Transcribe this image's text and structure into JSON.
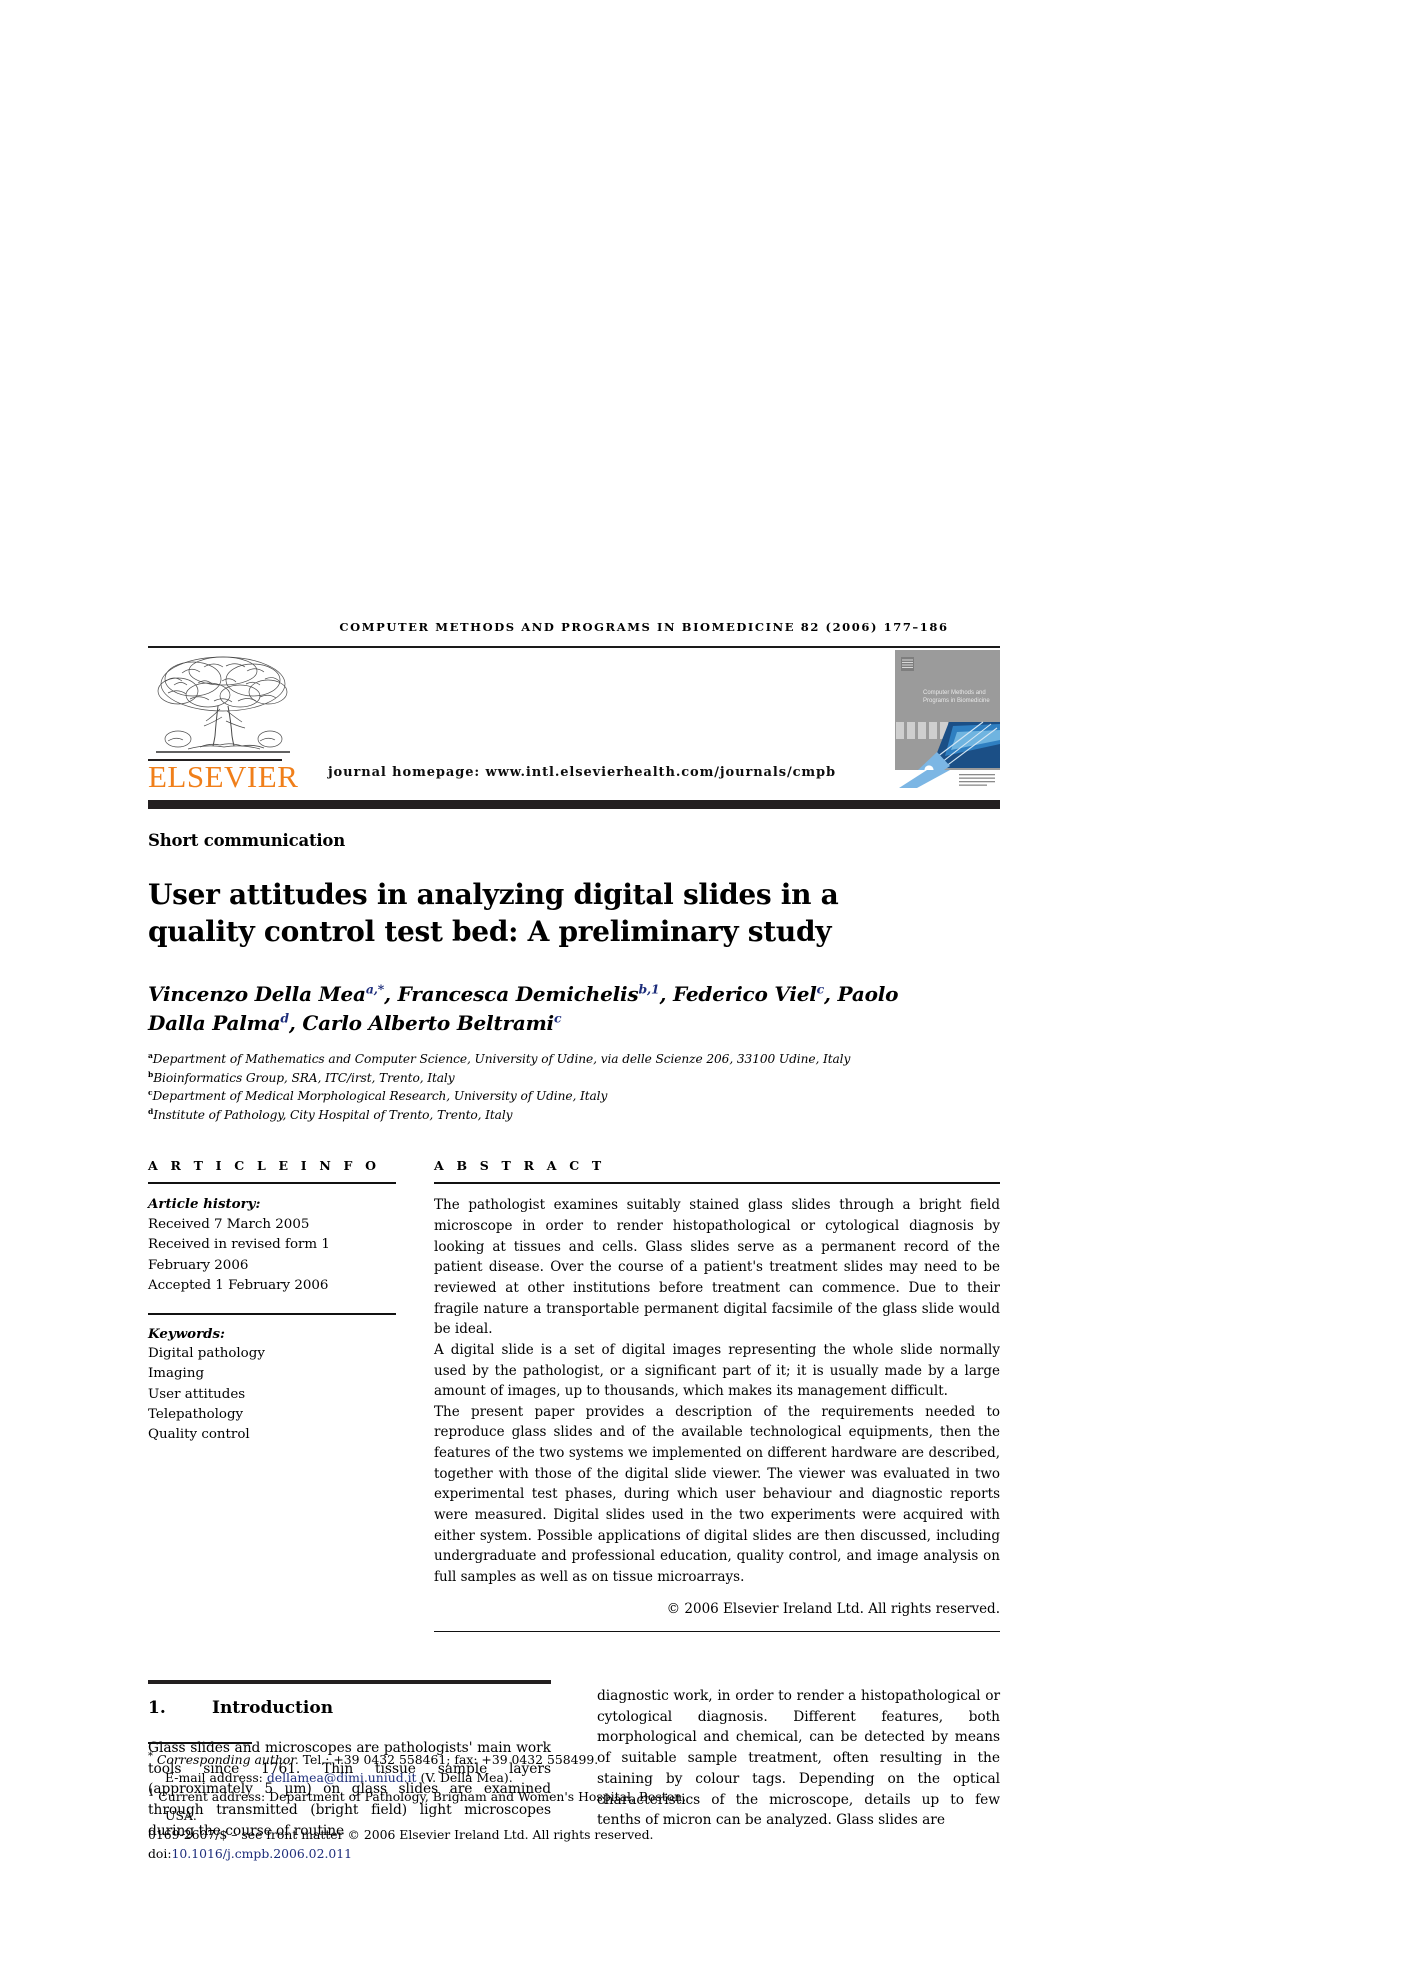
{
  "running_head": "COMPUTER METHODS AND PROGRAMS IN BIOMEDICINE 82 (2006) 177–186",
  "masthead": {
    "publisher": "ELSEVIER",
    "homepage": "journal homepage: www.intl.elsevierhealth.com/journals/cmpb",
    "cover": {
      "journal_title_line1": "Computer Methods and",
      "journal_title_line2": "Programs in Biomedicine"
    },
    "colors": {
      "elsevier_orange": "#F07F1A",
      "rule_dark": "#231f20",
      "cover_gray": "#9d9d9d",
      "cover_blue": "#2b6cb0"
    }
  },
  "article_type": "Short communication",
  "title": "User attitudes in analyzing digital slides in a quality control test bed: A preliminary study",
  "authors_html": "Vincenzo Della Mea<sup>a,*</sup>, Francesca Demichelis<sup>b,1</sup>, Federico Viel<sup>c</sup>, Paolo Dalla Palma<sup>d</sup>, Carlo Alberto Beltrami<sup>c</sup>",
  "affiliations": [
    {
      "mark": "a",
      "text": "Department of Mathematics and Computer Science, University of Udine, via delle Scienze 206, 33100 Udine, Italy"
    },
    {
      "mark": "b",
      "text": "Bioinformatics Group, SRA, ITC/irst, Trento, Italy"
    },
    {
      "mark": "c",
      "text": "Department of Medical Morphological Research, University of Udine, Italy"
    },
    {
      "mark": "d",
      "text": "Institute of Pathology, City Hospital of Trento, Trento, Italy"
    }
  ],
  "article_info": {
    "label": "A R T I C L E   I N F O",
    "history_heading": "Article history:",
    "history": [
      "Received 7 March 2005",
      "Received in revised form 1 February 2006",
      "Accepted 1 February 2006"
    ],
    "keywords_heading": "Keywords:",
    "keywords": [
      "Digital pathology",
      "Imaging",
      "User attitudes",
      "Telepathology",
      "Quality control"
    ]
  },
  "abstract": {
    "label": "A B S T R A C T",
    "paragraphs": [
      "The pathologist examines suitably stained glass slides through a bright field microscope in order to render histopathological or cytological diagnosis by looking at tissues and cells. Glass slides serve as a permanent record of the patient disease. Over the course of a patient's treatment slides may need to be reviewed at other institutions before treatment can commence. Due to their fragile nature a transportable permanent digital facsimile of the glass slide would be ideal.",
      "A digital slide is a set of digital images representing the whole slide normally used by the pathologist, or a significant part of it; it is usually made by a large amount of images, up to thousands, which makes its management difficult.",
      "The present paper provides a description of the requirements needed to reproduce glass slides and of the available technological equipments, then the features of the two systems we implemented on different hardware are described, together with those of the digital slide viewer. The viewer was evaluated in two experimental test phases, during which user behaviour and diagnostic reports were measured. Digital slides used in the two experiments were acquired with either system. Possible applications of digital slides are then discussed, including undergraduate and professional education, quality control, and image analysis on full samples as well as on tissue microarrays."
    ],
    "copyright": "© 2006 Elsevier Ireland Ltd. All rights reserved."
  },
  "section": {
    "number": "1.",
    "heading": "Introduction",
    "left_column": "Glass slides and microscopes are pathologists' main work tools since 1761. Thin tissue sample layers (approximately 5 µm) on glass slides are examined through transmitted (bright field) light microscopes during the course of routine",
    "right_column": "diagnostic work, in order to render a histopathological or cytological diagnosis. Different features, both morphological and chemical, can be detected by means of suitable sample treatment, often resulting in the staining by colour tags. Depending on the optical characteristics of the microscope, details up to few tenths of micron can be analyzed. Glass slides are"
  },
  "footnotes": {
    "corresponding_mark": "*",
    "corresponding_label": "Corresponding author.",
    "corresponding_tel": " Tel.: +39 0432 558461; fax: +39 0432 558499.",
    "email_label": "E-mail address:",
    "email": "dellamea@dimi.uniud.it",
    "email_suffix": "(V. Della Mea).",
    "current_address_mark": "1",
    "current_address": "Current address: Department of Pathology, Brigham and Women's Hospital, Boston, USA.",
    "issn_line": "0169-2607/$ – see front matter © 2006 Elsevier Ireland Ltd. All rights reserved.",
    "doi_label": "doi:",
    "doi": "10.1016/j.cmpb.2006.02.011"
  }
}
